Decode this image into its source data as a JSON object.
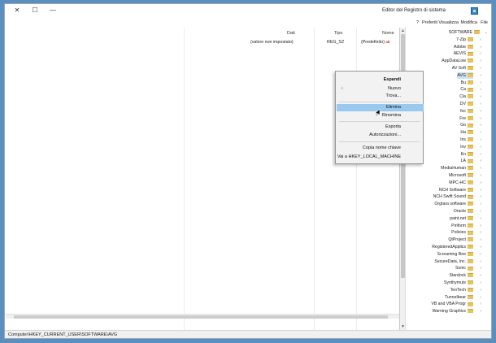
{
  "window": {
    "title": "Editor del Registro di sistema",
    "controls": {
      "minimize": "—",
      "maximize": "☐",
      "close": "✕"
    }
  },
  "menubar": [
    "File",
    "Modifica",
    "Visualizza",
    "Preferiti",
    "?"
  ],
  "values": {
    "columns": {
      "name": "Nome",
      "type": "Tipo",
      "data": "Dati"
    },
    "rows": [
      {
        "name": "(Predefinito)",
        "type": "REG_SZ",
        "data": "(valore non impostato)"
      }
    ]
  },
  "tree": {
    "items": [
      "SOFTWARE",
      "7-Zip",
      "Adobe",
      "AEVIS",
      "AppDataLow",
      "AV Soft",
      "AVG",
      "Bu",
      "Ca",
      "Cla",
      "DV",
      "foc",
      "Fre",
      "Go",
      "Ha",
      "Ins",
      "Inv",
      "Kn",
      "LA",
      "MediaHuman",
      "Microsoft",
      "MPC-HC",
      "NCH Software",
      "NCH Swift Sound",
      "Orgtara software",
      "Oracle",
      "paint.net",
      "Piriform",
      "Policies",
      "QtProject",
      "RegisteredApplics",
      "Screaming Bee",
      "SecureData, Inc.",
      "Sonic",
      "Stardock",
      "Synthymuts",
      "TeoTech",
      "Tunnelbear",
      "VB and VBA Progr",
      "Warning Graphics"
    ]
  },
  "context_menu": {
    "items": [
      {
        "label": "Espandi",
        "bold": true
      },
      {
        "label": "Nuovo",
        "submenu": true
      },
      {
        "label": "Trova..."
      },
      {
        "label": "Elimina",
        "highlight": true
      },
      {
        "label": "Rinomina"
      },
      {
        "label": "Esporta"
      },
      {
        "label": "Autorizzazioni..."
      },
      {
        "label": "Copia nome chiave"
      },
      {
        "label": "Vai a HKEY_LOCAL_MACHINE"
      }
    ]
  },
  "status": {
    "path": "Computer\\HKEY_CURRENT_USER\\SOFTWARE\\AVG"
  },
  "icons": {
    "folder": "folder-icon",
    "value": "reg-sz-icon",
    "app": "regedit-icon"
  }
}
